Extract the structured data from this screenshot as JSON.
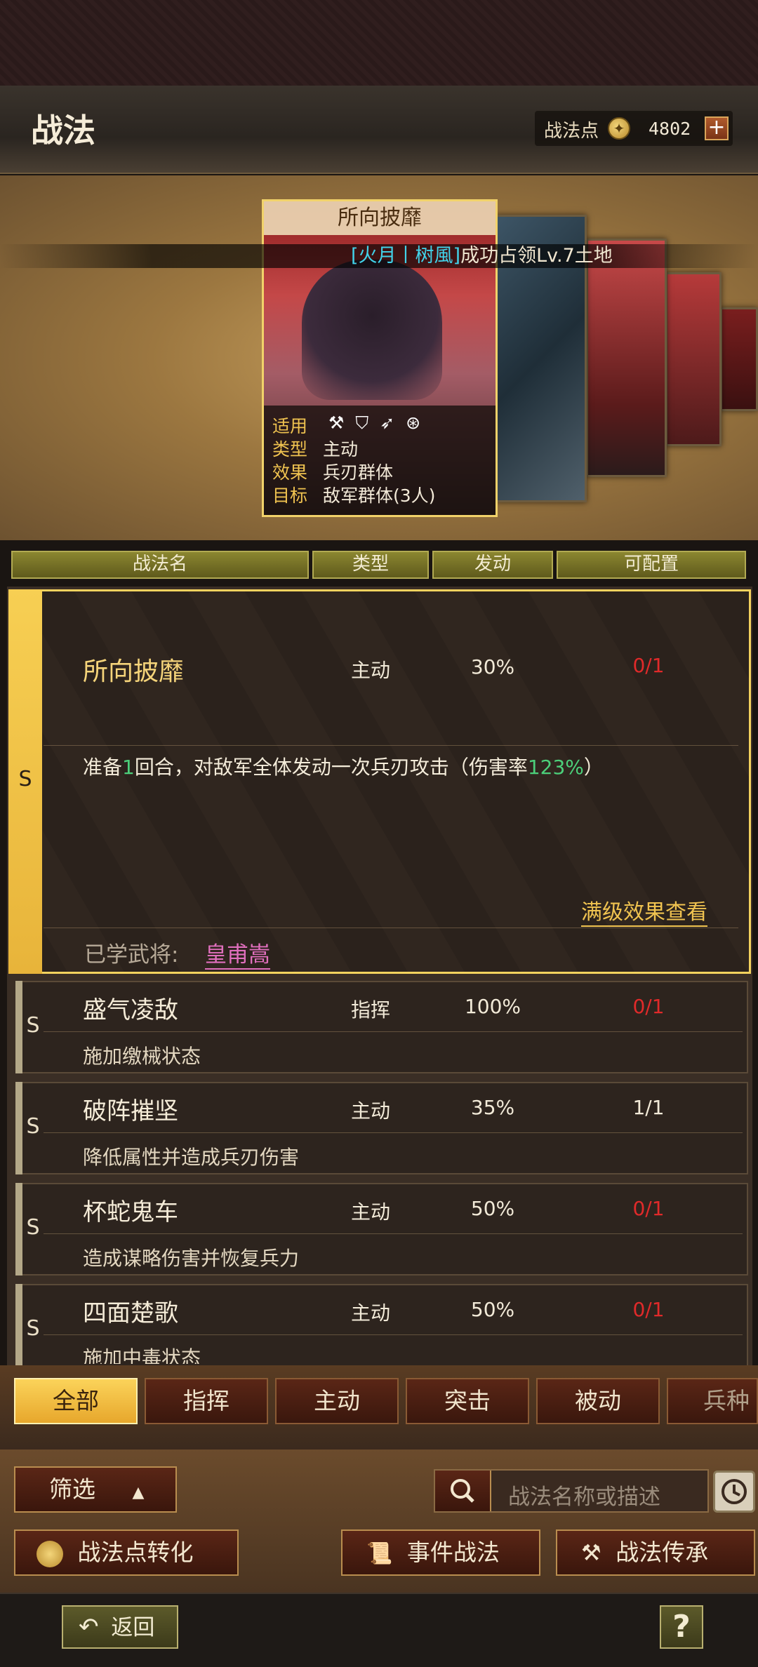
{
  "header": {
    "title": "战法",
    "points_label": "战法点",
    "points_value": "4802",
    "plus": "+"
  },
  "banner": {
    "highlight": "[火月丨树風]",
    "text": "成功占领Lv.7土地"
  },
  "card": {
    "name": "所向披靡",
    "rows": [
      {
        "key": "适用",
        "value": ""
      },
      {
        "key": "类型",
        "value": "主动"
      },
      {
        "key": "效果",
        "value": "兵刃群体"
      },
      {
        "key": "目标",
        "value": "敌军群体(3人)"
      }
    ],
    "applicable_icons": [
      "axe-icon",
      "shield-icon",
      "bow-icon",
      "wheel-icon"
    ]
  },
  "table_header": {
    "name": "战法名",
    "type": "类型",
    "trigger": "发动",
    "config": "可配置"
  },
  "selected": {
    "grade": "S",
    "name": "所向披靡",
    "type": "主动",
    "rate": "30%",
    "config": "0/1",
    "desc_prefix": "准备",
    "desc_num": "1",
    "desc_middle": "回合，对敌军全体发动一次兵刃攻击（伤害率",
    "desc_pct": "123%",
    "desc_suffix": "）",
    "full_link": "满级效果查看",
    "learned_label": "已学武将:",
    "learned_name": "皇甫嵩"
  },
  "items": [
    {
      "grade": "S",
      "name": "盛气凌敌",
      "type": "指挥",
      "rate": "100%",
      "config": "0/1",
      "desc": "施加缴械状态",
      "config_color": "#e02a2a"
    },
    {
      "grade": "S",
      "name": "破阵摧坚",
      "type": "主动",
      "rate": "35%",
      "config": "1/1",
      "desc": "降低属性并造成兵刃伤害",
      "config_color": "#f2ead8"
    },
    {
      "grade": "S",
      "name": "杯蛇鬼车",
      "type": "主动",
      "rate": "50%",
      "config": "0/1",
      "desc": "造成谋略伤害并恢复兵力",
      "config_color": "#e02a2a"
    },
    {
      "grade": "S",
      "name": "四面楚歌",
      "type": "主动",
      "rate": "50%",
      "config": "0/1",
      "desc": "施加中毒状态",
      "config_color": "#e02a2a"
    }
  ],
  "tabs": [
    "全部",
    "指挥",
    "主动",
    "突击",
    "被动",
    "兵种"
  ],
  "controls": {
    "filter": "筛选",
    "search_placeholder": "战法名称或描述",
    "convert": "战法点转化",
    "event": "事件战法",
    "inherit": "战法传承"
  },
  "footer": {
    "back": "返回",
    "help": "?"
  }
}
